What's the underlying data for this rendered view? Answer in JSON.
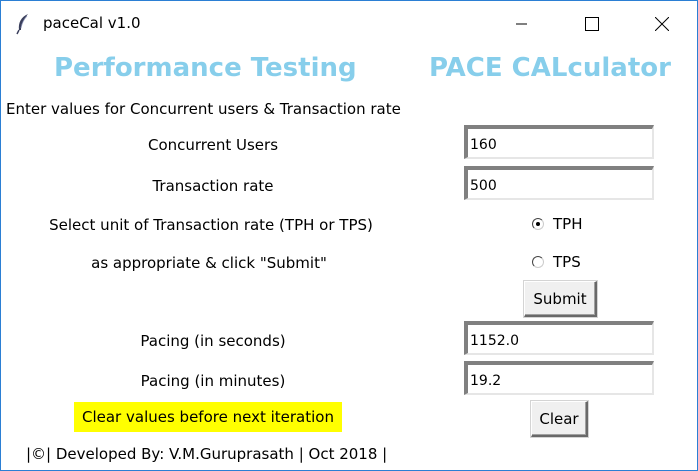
{
  "window": {
    "title": "paceCal v1.0"
  },
  "header": {
    "left": "Performance Testing",
    "right": "PACE CALculator",
    "color": "#87ceeb"
  },
  "intro": "Enter values for Concurrent users & Transaction rate",
  "form": {
    "concurrent_users_label": "Concurrent Users",
    "concurrent_users_value": "160",
    "transaction_rate_label": "Transaction rate",
    "transaction_rate_value": "500",
    "unit_prompt_line1": "Select unit of Transaction rate (TPH or TPS)",
    "unit_prompt_line2": "as appropriate & click  \"Submit\"",
    "unit_options": [
      {
        "label": "TPH",
        "selected": true
      },
      {
        "label": "TPS",
        "selected": false
      }
    ],
    "submit_label": "Submit"
  },
  "results": {
    "pacing_seconds_label": "Pacing (in seconds)",
    "pacing_seconds_value": "1152.0",
    "pacing_minutes_label": "Pacing (in minutes)",
    "pacing_minutes_value": "19.2"
  },
  "clear": {
    "note": "Clear values before next iteration",
    "note_color": "#ffff00",
    "button_label": "Clear"
  },
  "footer": "|©| Developed By: V.M.Guruprasath | Oct 2018 |"
}
